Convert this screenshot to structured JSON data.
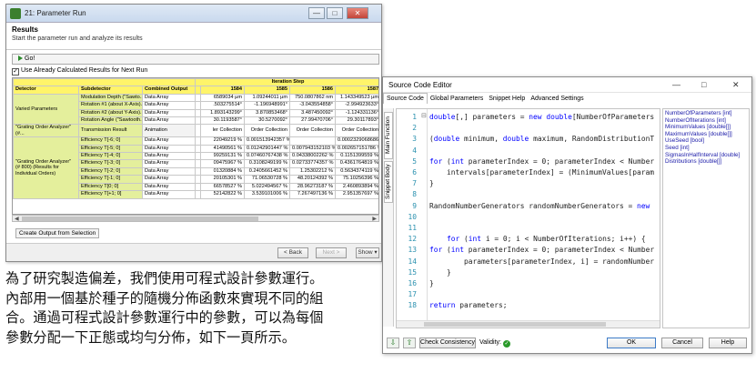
{
  "param_run": {
    "title": "21: Parameter Run",
    "controls": {
      "minimize": "—",
      "maximize": "□",
      "close": "✕"
    },
    "header_title": "Results",
    "header_subtitle": "Start the parameter run and analyze its results",
    "go_label": "Go!",
    "use_calculated_label": "Use Already Calculated Results for Next Run",
    "use_calculated_checked": true,
    "iteration_step_label": "Iteration Step",
    "columns": [
      "Detector",
      "Subdetector",
      "Combined Output",
      "1584",
      "1585",
      "1586",
      "1587"
    ],
    "rows": [
      {
        "detector": "Varied Parameters",
        "sub": "Modulation Depth (\"Sawto...",
        "combined": "Data Array",
        "v": [
          "6589034 µm",
          "1.09244011 µm",
          "750.0807862 nm",
          "1.143349523 µm"
        ]
      },
      {
        "detector": "",
        "sub": "Rotation #1 (about X-Axis)...",
        "combined": "Data Array",
        "v": ".503275514°",
        "v2": [
          "-1.196948991°",
          "-3.043554858°",
          "-2.994923633°"
        ]
      },
      {
        "detector": "",
        "sub": "Rotation #2 (about Y-Axis)...",
        "combined": "Data Array",
        "v": [
          "1.893143299°",
          "3.870853468°",
          "3.487450092°",
          "-1.124331136°"
        ]
      },
      {
        "detector": "",
        "sub": "Rotation Angle (\"Sawtooth...",
        "combined": "Data Array",
        "v": [
          "30.1193587°",
          "30.5270092°",
          "27.99470706°",
          "29.30117893°"
        ]
      },
      {
        "detector": "\"Grating Order Analyzer\" (#...",
        "sub": "Transmission Result",
        "combined": "Animation",
        "v": [
          "ler Collection",
          "Order Collection",
          "Order Collection",
          "Order Collection"
        ]
      },
      {
        "detector": "\"Grating Order Analyzer\" (# 800) (Results for Individual Orders)",
        "sub": "Efficiency T[-6; 0]",
        "combined": "Data Array",
        "v": [
          "22049219 %",
          "0.001513942357 %",
          "",
          "0.0002329068686 %"
        ]
      },
      {
        "detector": "",
        "sub": "Efficiency T[-5; 0]",
        "combined": "Data Array",
        "v": [
          "41490561 %",
          "0.01242901447 %",
          "0.007943152103 %",
          "0.002657151786 %"
        ]
      },
      {
        "detector": "",
        "sub": "Efficiency T[-4; 0]",
        "combined": "Data Array",
        "v": [
          "99259131 %",
          "0.07460767438 %",
          "0.04338002262 %",
          "0.1151399559 %"
        ]
      },
      {
        "detector": "",
        "sub": "Efficiency T[-3; 0]",
        "combined": "Data Array",
        "v": [
          "09475967 %",
          "0.3108249199 %",
          "0.02733774357 %",
          "0.4361764819 %"
        ]
      },
      {
        "detector": "",
        "sub": "Efficiency T[-2; 0]",
        "combined": "Data Array",
        "v": [
          "01320884 %",
          "0.2405661452 %",
          "1.25302212 %",
          "0.5634374119 %"
        ]
      },
      {
        "detector": "",
        "sub": "Efficiency T[-1; 0]",
        "combined": "Data Array",
        "v": [
          "20105301 %",
          "71.06530728 %",
          "48.20124392 %",
          "75.10256396 %"
        ]
      },
      {
        "detector": "",
        "sub": "Efficiency T[0; 0]",
        "combined": "Data Array",
        "v": [
          "66578527 %",
          "5.022494567 %",
          "28.96273187 %",
          "2.460893894 %"
        ]
      },
      {
        "detector": "",
        "sub": "Efficiency T[+1; 0]",
        "combined": "Data Array",
        "v": [
          "52142822 %",
          "3.539101006 %",
          "7.267497136 %",
          "2.951357697 %"
        ]
      }
    ],
    "create_output_label": "Create Output from Selection",
    "footer": {
      "back": "< Back",
      "next": "Next >",
      "show": "Show ▾"
    }
  },
  "editor": {
    "title": "Source Code Editor",
    "controls": {
      "minimize": "—",
      "maximize": "□",
      "close": "✕"
    },
    "tabs": [
      "Source Code",
      "Global Parameters",
      "Snippet Help",
      "Advanced Settings"
    ],
    "side_tabs": [
      "Main Function",
      "Snippet Body"
    ],
    "lines": [
      {
        "n": "1",
        "code": "double[,] parameters = new double[NumberOfParameters"
      },
      {
        "n": "2",
        "code": ""
      },
      {
        "n": "3",
        "code": "(double minimum, double maximum, RandomDistributionT"
      },
      {
        "n": "4",
        "code": ""
      },
      {
        "n": "5",
        "code": "for (int parameterIndex = 0; parameterIndex < Number"
      },
      {
        "n": "6",
        "code": "    intervals[parameterIndex] = (MinimumValues[param"
      },
      {
        "n": "7",
        "code": "}"
      },
      {
        "n": "8",
        "code": ""
      },
      {
        "n": "9",
        "code": "RandomNumberGenerators randomNumberGenerators = new"
      },
      {
        "n": "10",
        "code": ""
      },
      {
        "n": "11",
        "code": ""
      },
      {
        "n": "12",
        "code": "    for (int i = 0; i < NumberOfIterations; i++) {"
      },
      {
        "n": "13",
        "code": "for (int parameterIndex = 0; parameterIndex < Number"
      },
      {
        "n": "14",
        "code": "        parameters[parameterIndex, i] = randomNumber"
      },
      {
        "n": "15",
        "code": "    }"
      },
      {
        "n": "16",
        "code": "}"
      },
      {
        "n": "17",
        "code": ""
      },
      {
        "n": "18",
        "code": "return parameters;"
      }
    ],
    "params": [
      "NumberOfParameters [int]",
      "NumberOfIterations [int]",
      "MinimumValues [double[]]",
      "MaximumValues [double[]]",
      "UseSeed [bool]",
      "Seed [int]",
      "SigmasInHalfInterval [double]",
      "Distributions [double[]]"
    ],
    "check_label": "Check Consistency",
    "validity_label": "Validity:",
    "ok_label": "OK",
    "cancel_label": "Cancel",
    "help_label": "Help"
  },
  "caption": [
    "為了研究製造偏差，我們使用可程式設計參數運行。",
    "內部用一個基於種子的隨機分佈函數來實現不同的組",
    "合。通過可程式設計參數運行中的參數，可以為每個",
    "參數分配一下正態或均勻分佈，如下一頁所示。"
  ]
}
